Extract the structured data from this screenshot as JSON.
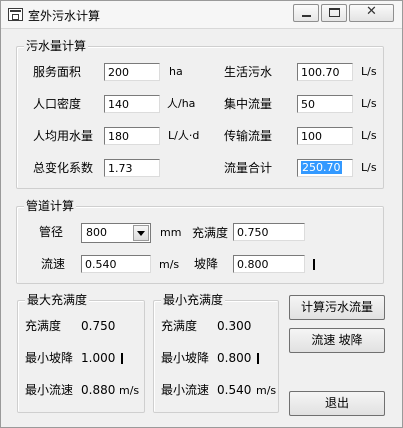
{
  "window": {
    "title": "室外污水计算"
  },
  "sewage": {
    "legend": "污水量计算",
    "service_area": {
      "label": "服务面积",
      "value": "200",
      "unit": "ha"
    },
    "pop_density": {
      "label": "人口密度",
      "value": "140",
      "unit": "人/ha"
    },
    "water_per_capita": {
      "label": "人均用水量",
      "value": "180",
      "unit": "L/人·d"
    },
    "total_variation": {
      "label": "总变化系数",
      "value": "1.73"
    },
    "domestic_sewage": {
      "label": "生活污水",
      "value": "100.70",
      "unit": "L/s"
    },
    "concentrated_flow": {
      "label": "集中流量",
      "value": "50",
      "unit": "L/s"
    },
    "transport_flow": {
      "label": "传输流量",
      "value": "100",
      "unit": "L/s"
    },
    "total_flow": {
      "label": "流量合计",
      "value": "250.70",
      "unit": "L/s"
    }
  },
  "pipe": {
    "legend": "管道计算",
    "diameter": {
      "label": "管径",
      "value": "800",
      "unit": "mm"
    },
    "fullness": {
      "label": "充满度",
      "value": "0.750"
    },
    "velocity": {
      "label": "流速",
      "value": "0.540",
      "unit": "m/s"
    },
    "slope": {
      "label": "坡降",
      "value": "0.800"
    }
  },
  "max_fullness": {
    "legend": "最大充满度",
    "fullness_label": "充满度",
    "fullness_value": "0.750",
    "min_slope_label": "最小坡降",
    "min_slope_value": "1.000",
    "min_velocity_label": "最小流速",
    "min_velocity_value": "0.880",
    "velocity_unit": "m/s"
  },
  "min_fullness": {
    "legend": "最小充满度",
    "fullness_label": "充满度",
    "fullness_value": "0.300",
    "min_slope_label": "最小坡降",
    "min_slope_value": "0.800",
    "min_velocity_label": "最小流速",
    "min_velocity_value": "0.540",
    "velocity_unit": "m/s"
  },
  "buttons": {
    "calc_sewage": "计算污水流量",
    "velocity_slope": "流速  坡降",
    "exit": "退出"
  },
  "icons": {
    "app": "app-window-icon",
    "minimize": "minimize-icon",
    "maximize": "maximize-icon",
    "close": "close-icon"
  }
}
